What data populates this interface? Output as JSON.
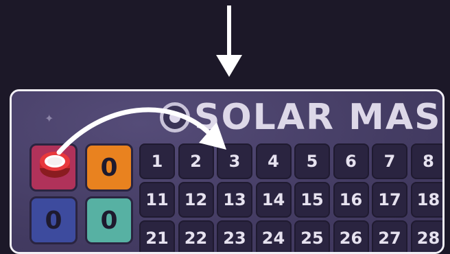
{
  "board": {
    "title": "SOLAR MAS",
    "counters": [
      {
        "name": "red-counter",
        "value": "",
        "color": "#b0325a"
      },
      {
        "name": "orange-counter",
        "value": "0",
        "color": "#e9821f"
      },
      {
        "name": "blue-counter",
        "value": "0",
        "color": "#3d4b9e"
      },
      {
        "name": "teal-counter",
        "value": "0",
        "color": "#57b1a3"
      }
    ],
    "rows": [
      [
        "1",
        "2",
        "3",
        "4",
        "5",
        "6",
        "7",
        "8"
      ],
      [
        "11",
        "12",
        "13",
        "14",
        "15",
        "16",
        "17",
        "18"
      ],
      [
        "21",
        "22",
        "23",
        "24",
        "25",
        "26",
        "27",
        "28"
      ]
    ]
  },
  "icons": {
    "down_arrow": "arrow-down-icon",
    "curved_arrow": "curved-arrow-icon",
    "sparkle": "sparkle-icon",
    "token": "red-token-icon"
  }
}
